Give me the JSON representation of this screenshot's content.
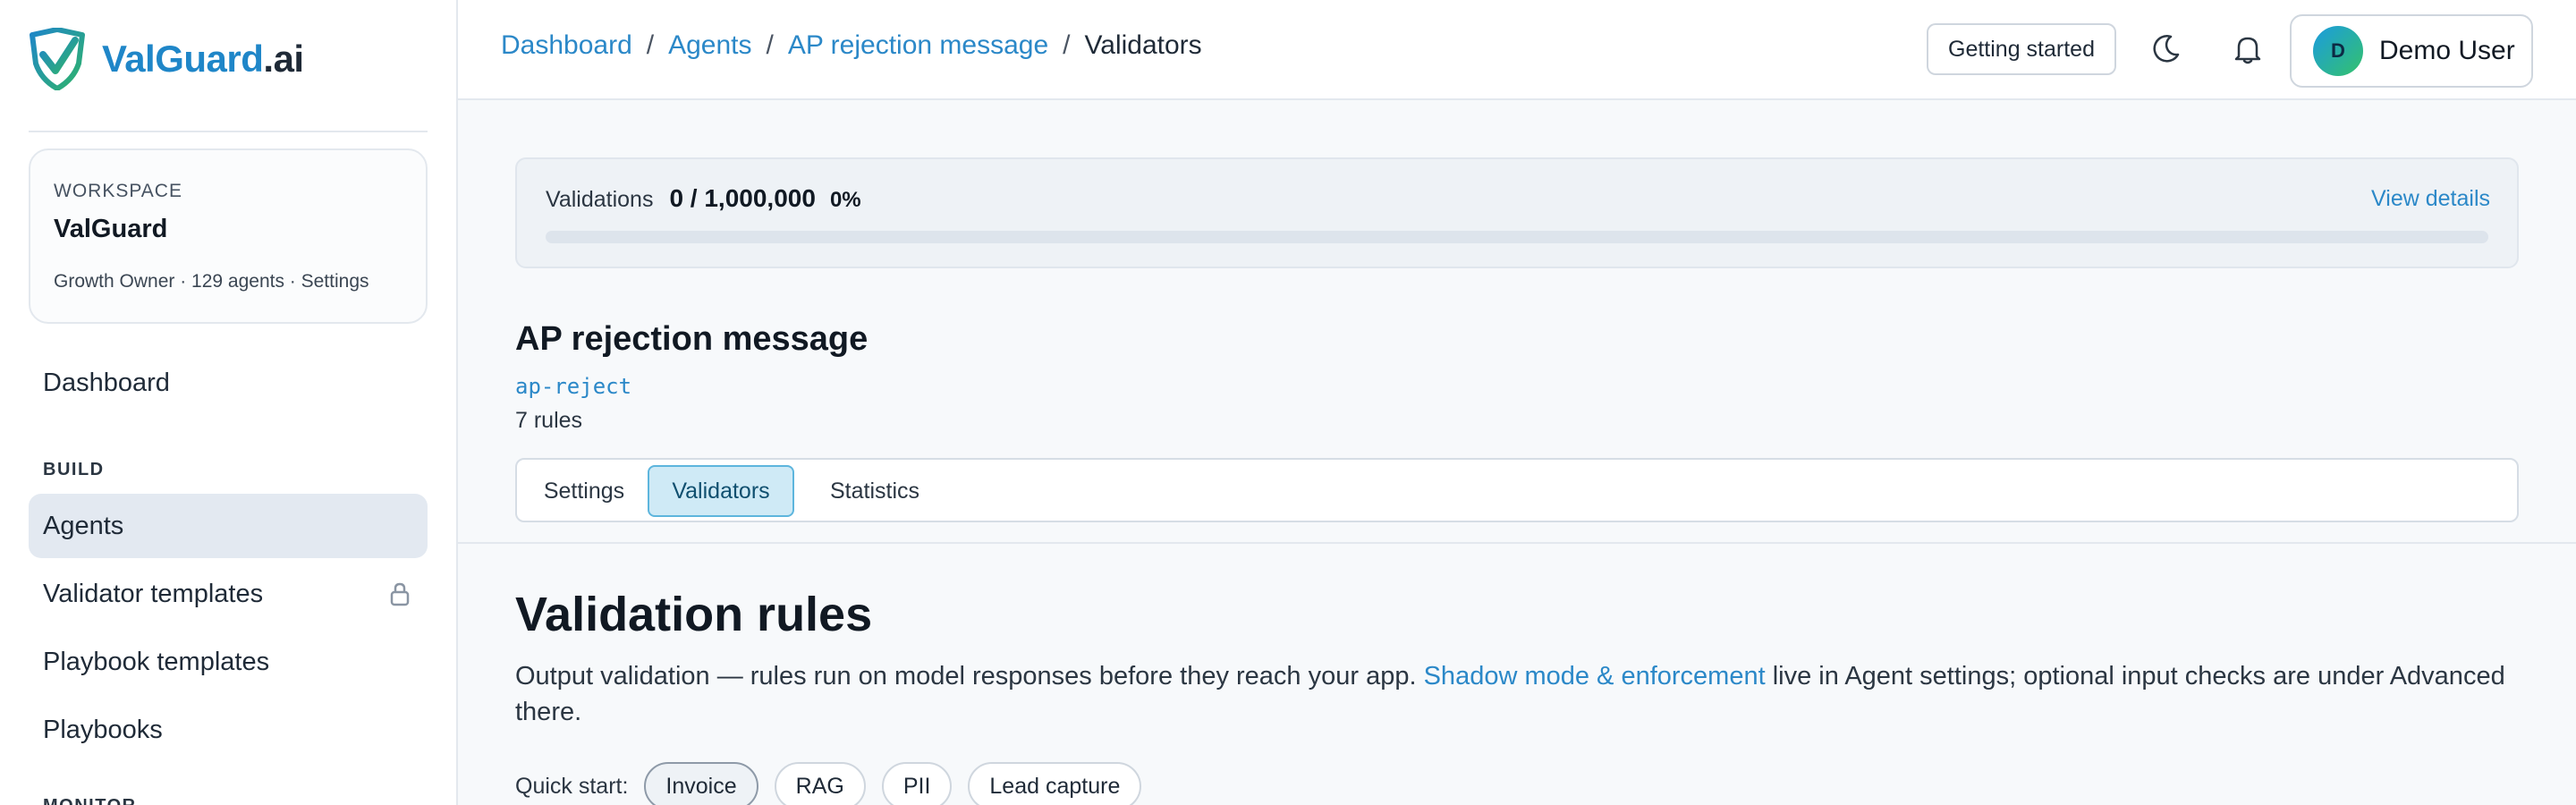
{
  "brand": {
    "name_part1": "ValGuard",
    "name_part2": ".ai",
    "accent": "#1f86c8"
  },
  "workspace": {
    "kicker": "WORKSPACE",
    "name": "ValGuard",
    "meta": "Growth Owner · 129 agents · Settings"
  },
  "sidebar": {
    "dashboard": "Dashboard",
    "build_section": "BUILD",
    "items": [
      {
        "label": "Agents",
        "active": true
      },
      {
        "label": "Validator templates",
        "locked": true
      },
      {
        "label": "Playbook templates"
      },
      {
        "label": "Playbooks"
      }
    ],
    "next_section": "MONITOR"
  },
  "breadcrumb": {
    "items": [
      "Dashboard",
      "Agents",
      "AP rejection message"
    ],
    "separator": "/",
    "current": "Validators"
  },
  "topbar": {
    "getting_started": "Getting started",
    "theme_icon": "moon-icon",
    "notifications_icon": "bell-icon"
  },
  "user": {
    "initial": "D",
    "name": "Demo User"
  },
  "usage": {
    "label": "Validations",
    "count": "0 / 1,000,000",
    "percent": "0%",
    "fraction": 0,
    "link": "View details"
  },
  "agent": {
    "title": "AP rejection message",
    "slug": "ap-reject",
    "rules": "7 rules"
  },
  "tabs": [
    {
      "label": "Settings"
    },
    {
      "label": "Validators",
      "active": true
    },
    {
      "label": "Statistics"
    }
  ],
  "section": {
    "title": "Validation rules",
    "desc_before": "Output validation — rules run on model responses before they reach your app. ",
    "desc_link": "Shadow mode & enforcement",
    "desc_after": " live in Agent settings; optional input checks are under Advanced there."
  },
  "quick_start": {
    "label": "Quick start:",
    "chips": [
      "Invoice",
      "RAG",
      "PII",
      "Lead capture"
    ]
  }
}
